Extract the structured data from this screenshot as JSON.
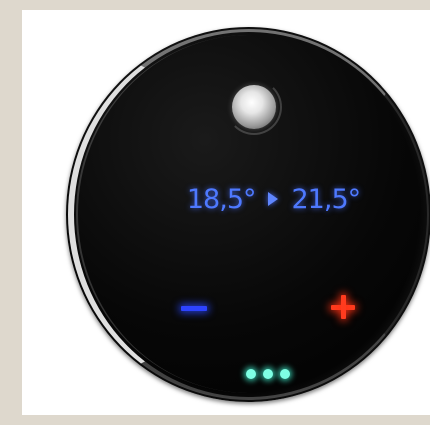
{
  "thermostat": {
    "current_temp": "18,5°",
    "target_temp": "21,5°",
    "arrow_icon": "arrow-right-icon",
    "decrease_icon": "minus-icon",
    "increase_icon": "plus-icon",
    "menu_icon": "more-dots-icon",
    "knob_icon": "power-knob-icon"
  },
  "colors": {
    "temp_text": "#4e79ff",
    "minus": "#2d43ff",
    "plus": "#ff3b1e",
    "dots": "#7fffe4",
    "background": "#ded8cd"
  }
}
